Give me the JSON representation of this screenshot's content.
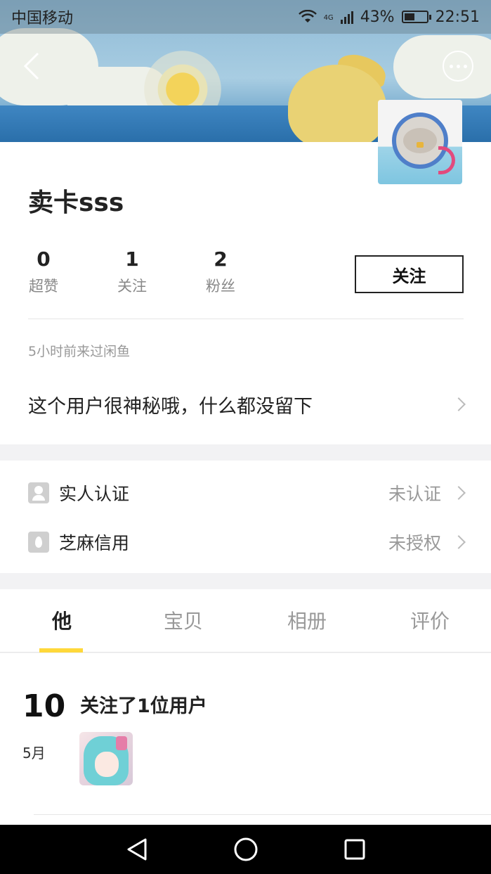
{
  "status_bar": {
    "carrier": "中国移动",
    "network": "4G",
    "battery": "43%",
    "battery_level": 0.43,
    "time": "22:51"
  },
  "header": {
    "back_icon": "chevron-left-icon",
    "more_icon": "more-dots-icon"
  },
  "profile": {
    "username": "卖卡sss",
    "stats": [
      {
        "value": "0",
        "label": "超赞"
      },
      {
        "value": "1",
        "label": "关注"
      },
      {
        "value": "2",
        "label": "粉丝"
      }
    ],
    "follow_label": "关注",
    "last_visit": "5小时前来过闲鱼",
    "bio": "这个用户很神秘哦，什么都没留下"
  },
  "verification": [
    {
      "icon": "person-icon",
      "label": "实人认证",
      "status": "未认证"
    },
    {
      "icon": "sesame-icon",
      "label": "芝麻信用",
      "status": "未授权"
    }
  ],
  "tabs": [
    {
      "label": "他",
      "active": true
    },
    {
      "label": "宝贝",
      "active": false
    },
    {
      "label": "相册",
      "active": false
    },
    {
      "label": "评价",
      "active": false
    }
  ],
  "colors": {
    "tab_indicator": "#ffd83a",
    "text_primary": "#222222",
    "text_secondary": "#999999"
  },
  "feed": {
    "day": "10",
    "month": "5月",
    "title": "关注了1位用户"
  },
  "nav_bar": {
    "back_icon": "triangle-back-icon",
    "home_icon": "circle-home-icon",
    "recent_icon": "square-recent-icon"
  }
}
